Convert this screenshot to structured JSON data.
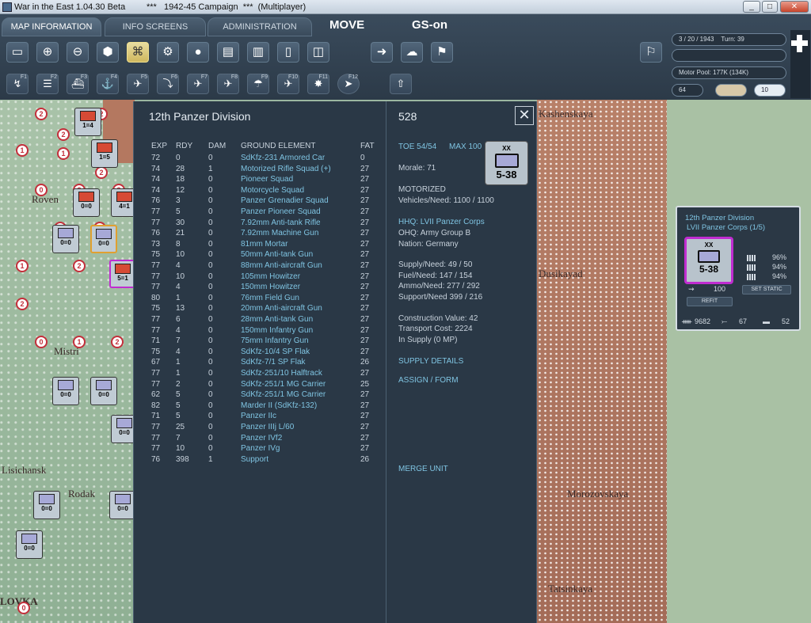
{
  "window": {
    "title": "War in the East 1.04.30 Beta",
    "campaign": "***   1942-45 Campaign  ***  (Multiplayer)"
  },
  "tabs": [
    {
      "label": "MAP INFORMATION"
    },
    {
      "label": "INFO SCREENS"
    },
    {
      "label": "ADMINISTRATION"
    }
  ],
  "mode": {
    "move": "MOVE",
    "gs": "GS-on"
  },
  "info": {
    "date": "3 / 20 / 1943",
    "turn": "Turn: 39",
    "motor_pool": "Motor Pool: 177K (134K)",
    "value64": "64",
    "value10": "10"
  },
  "toolbar_row1": [
    "layers-icon",
    "zoom-in-icon",
    "zoom-out-icon",
    "hex-grid-icon",
    "unit-frame-icon",
    "gear-icon",
    "unit-select-icon",
    "hq-icon",
    "factory-icon",
    "box-icon",
    "airbase-icon",
    "move-arrow-icon",
    "weather-icon",
    "flag-icon"
  ],
  "toolbar_row2": [
    {
      "icon": "path-icon",
      "fkey": "F1"
    },
    {
      "icon": "rail-icon",
      "fkey": "F2"
    },
    {
      "icon": "ship-icon",
      "fkey": "F3"
    },
    {
      "icon": "naval-icon",
      "fkey": "F4"
    },
    {
      "icon": "air-recon-icon",
      "fkey": "F5"
    },
    {
      "icon": "ground-attack-icon",
      "fkey": "F6"
    },
    {
      "icon": "air-transport-icon",
      "fkey": "F7"
    },
    {
      "icon": "airfield-attack-icon",
      "fkey": "F8"
    },
    {
      "icon": "paradrop-icon",
      "fkey": "F9"
    },
    {
      "icon": "bomb-icon",
      "fkey": "F10"
    },
    {
      "icon": "explosion-icon",
      "fkey": "F11"
    },
    {
      "icon": "target-icon",
      "fkey": "F12"
    }
  ],
  "unit": {
    "title": "12th Panzer Division",
    "number": "528",
    "headers": {
      "exp": "EXP",
      "rdy": "RDY",
      "dam": "DAM",
      "name": "GROUND ELEMENT",
      "fat": "FAT"
    },
    "elements": [
      {
        "exp": "72",
        "rdy": "0",
        "dam": "0",
        "name": "SdKfz-231 Armored Car",
        "fat": "0"
      },
      {
        "exp": "74",
        "rdy": "28",
        "dam": "1",
        "name": "Motorized Rifle Squad (+)",
        "fat": "27"
      },
      {
        "exp": "74",
        "rdy": "18",
        "dam": "0",
        "name": "Pioneer Squad",
        "fat": "27"
      },
      {
        "exp": "74",
        "rdy": "12",
        "dam": "0",
        "name": "Motorcycle Squad",
        "fat": "27"
      },
      {
        "exp": "76",
        "rdy": "3",
        "dam": "0",
        "name": "Panzer Grenadier Squad",
        "fat": "27"
      },
      {
        "exp": "77",
        "rdy": "5",
        "dam": "0",
        "name": "Panzer Pioneer Squad",
        "fat": "27"
      },
      {
        "exp": "77",
        "rdy": "30",
        "dam": "0",
        "name": "7.92mm Anti-tank Rifle",
        "fat": "27"
      },
      {
        "exp": "76",
        "rdy": "21",
        "dam": "0",
        "name": "7.92mm Machine Gun",
        "fat": "27"
      },
      {
        "exp": "73",
        "rdy": "8",
        "dam": "0",
        "name": "81mm Mortar",
        "fat": "27"
      },
      {
        "exp": "75",
        "rdy": "10",
        "dam": "0",
        "name": "50mm Anti-tank Gun",
        "fat": "27"
      },
      {
        "exp": "77",
        "rdy": "4",
        "dam": "0",
        "name": "88mm Anti-aircraft Gun",
        "fat": "27"
      },
      {
        "exp": "77",
        "rdy": "10",
        "dam": "0",
        "name": "105mm Howitzer",
        "fat": "27"
      },
      {
        "exp": "77",
        "rdy": "4",
        "dam": "0",
        "name": "150mm Howitzer",
        "fat": "27"
      },
      {
        "exp": "80",
        "rdy": "1",
        "dam": "0",
        "name": "76mm Field Gun",
        "fat": "27"
      },
      {
        "exp": "75",
        "rdy": "13",
        "dam": "0",
        "name": "20mm Anti-aircraft Gun",
        "fat": "27"
      },
      {
        "exp": "77",
        "rdy": "6",
        "dam": "0",
        "name": "28mm Anti-tank Gun",
        "fat": "27"
      },
      {
        "exp": "77",
        "rdy": "4",
        "dam": "0",
        "name": "150mm Infantry Gun",
        "fat": "27"
      },
      {
        "exp": "71",
        "rdy": "7",
        "dam": "0",
        "name": "75mm Infantry Gun",
        "fat": "27"
      },
      {
        "exp": "75",
        "rdy": "4",
        "dam": "0",
        "name": "SdKfz-10/4 SP Flak",
        "fat": "27"
      },
      {
        "exp": "67",
        "rdy": "1",
        "dam": "0",
        "name": "SdKfz-7/1 SP Flak",
        "fat": "26"
      },
      {
        "exp": "77",
        "rdy": "1",
        "dam": "0",
        "name": "SdKfz-251/10 Halftrack",
        "fat": "27"
      },
      {
        "exp": "77",
        "rdy": "2",
        "dam": "0",
        "name": "SdKfz-251/1 MG Carrier",
        "fat": "25"
      },
      {
        "exp": "62",
        "rdy": "5",
        "dam": "0",
        "name": "SdKfz-251/1 MG Carrier",
        "fat": "27"
      },
      {
        "exp": "82",
        "rdy": "5",
        "dam": "0",
        "name": "Marder II (SdKfz-132)",
        "fat": "27"
      },
      {
        "exp": "71",
        "rdy": "5",
        "dam": "0",
        "name": "Panzer IIc",
        "fat": "27"
      },
      {
        "exp": "77",
        "rdy": "25",
        "dam": "0",
        "name": "Panzer IIIj L/60",
        "fat": "27"
      },
      {
        "exp": "77",
        "rdy": "7",
        "dam": "0",
        "name": "Panzer IVf2",
        "fat": "27"
      },
      {
        "exp": "77",
        "rdy": "10",
        "dam": "0",
        "name": "Panzer IVg",
        "fat": "27"
      },
      {
        "exp": "76",
        "rdy": "398",
        "dam": "1",
        "name": "Support",
        "fat": "26"
      }
    ],
    "toe": "TOE 54/54",
    "max": "MAX 100",
    "morale": "Morale:   71",
    "motorized": "MOTORIZED",
    "vehicles": "Vehicles/Need:   1100 / 1100",
    "hhq": "HHQ: LVII Panzer Corps",
    "ohq": "OHQ: Army Group B",
    "nation": "Nation:   Germany",
    "supply": "Supply/Need:   49 / 50",
    "fuel": "Fuel/Need:        147 / 154",
    "ammo": "Ammo/Need:    277 / 292",
    "support": "Support/Need    399 / 216",
    "construction": "Construction Value:  42",
    "transport": "Transport Cost:     2224",
    "insupply": "In Supply (0 MP)",
    "supply_details": "SUPPLY DETAILS",
    "assign_form": "ASSIGN / FORM",
    "merge_unit": "MERGE UNIT",
    "counter": {
      "size": "XX",
      "value": "5-38"
    }
  },
  "side": {
    "line1": "12th Panzer Division",
    "line2": "LVII Panzer Corps (1/5)",
    "counter": {
      "size": "XX",
      "value": "5-38"
    },
    "pct1": "96%",
    "pct2": "94%",
    "pct3": "94%",
    "motor": "100",
    "refit": "REFIT",
    "set_static": "SET STATIC",
    "men": "9682",
    "guns": "67",
    "tanks": "52"
  },
  "map_labels": [
    "Roven",
    "Mistri",
    "Lisichansk",
    "Rodak",
    "LOVKA",
    "Kashenskaya",
    "Morozovskaya",
    "Tatsinkaya",
    "Dusikayad"
  ],
  "colors": {
    "panel": "#2a3846",
    "accent": "#7fc4e2",
    "selection": "#c02cd0",
    "soviet": "#c32f3b"
  }
}
